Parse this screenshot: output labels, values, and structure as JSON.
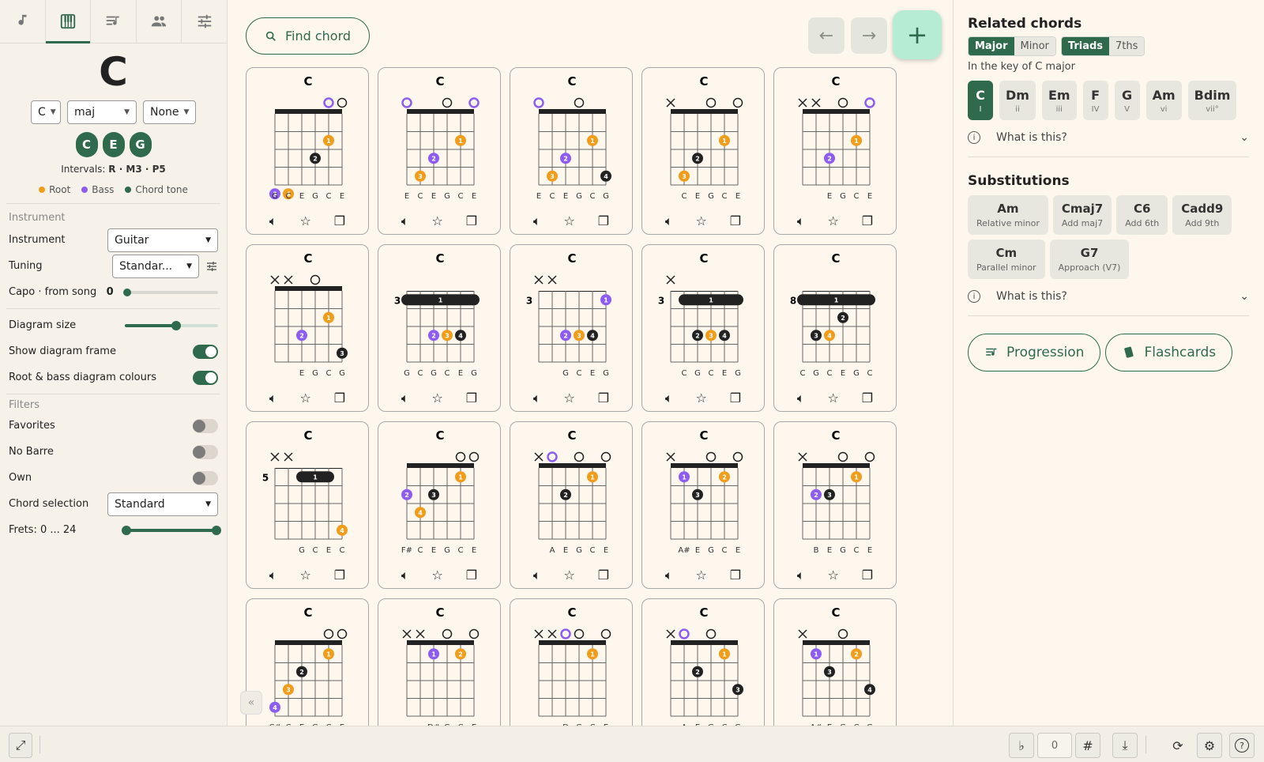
{
  "tabs": [
    "note-icon",
    "piano-icon",
    "playlist-icon",
    "people-icon",
    "sliders-icon"
  ],
  "chord": {
    "name": "C",
    "root": "C",
    "quality": "maj",
    "bass": "None",
    "notes": [
      "C",
      "E",
      "G"
    ],
    "intervals_label": "Intervals:",
    "intervals": "R · M3 · P5",
    "legend": {
      "root": "Root",
      "bass": "Bass",
      "chord_tone": "Chord tone"
    }
  },
  "colors": {
    "accent": "#2f6a4c",
    "root": "#f29d1a",
    "bass": "#8e5cf0",
    "tone": "#222222"
  },
  "settings": {
    "instrument_section": "Instrument",
    "instrument_label": "Instrument",
    "instrument_value": "Guitar",
    "tuning_label": "Tuning",
    "tuning_value": "Standar...",
    "capo_label": "Capo · from song",
    "capo_value": "0",
    "diagram_size_label": "Diagram size",
    "diagram_size_level": 0.55,
    "show_frame_label": "Show diagram frame",
    "show_frame": true,
    "root_bass_label": "Root & bass diagram colours",
    "root_bass": true,
    "filters_section": "Filters",
    "favorites_label": "Favorites",
    "favorites": false,
    "no_barre_label": "No Barre",
    "no_barre": false,
    "own_label": "Own",
    "own": false,
    "chord_selection_label": "Chord selection",
    "chord_selection_value": "Standard",
    "frets_label": "Frets: 0 ... 24",
    "frets_range": [
      0,
      24
    ]
  },
  "toolbar": {
    "find_label": "Find chord"
  },
  "diagrams": [
    {
      "name": "C",
      "base": 1,
      "markers": [
        "",
        "",
        "",
        "",
        "ob",
        "o"
      ],
      "dots": [
        [
          5,
          2,
          "r",
          1
        ],
        [
          4,
          3,
          "t",
          2
        ],
        [
          1,
          5,
          "b",
          3
        ],
        [
          2,
          5,
          "r",
          4
        ]
      ],
      "notes": [
        "G",
        "C",
        "E",
        "G",
        "C",
        "E"
      ]
    },
    {
      "name": "C",
      "base": 1,
      "markers": [
        "ob",
        "",
        "",
        "o",
        "",
        "ob"
      ],
      "dots": [
        [
          5,
          2,
          "r",
          1
        ],
        [
          3,
          3,
          "b",
          2
        ],
        [
          2,
          4,
          "r",
          3
        ]
      ],
      "notes": [
        "E",
        "C",
        "E",
        "G",
        "C",
        "E"
      ]
    },
    {
      "name": "C",
      "base": 1,
      "markers": [
        "ob",
        "",
        "",
        "o",
        "",
        ""
      ],
      "dots": [
        [
          5,
          2,
          "r",
          1
        ],
        [
          3,
          3,
          "b",
          2
        ],
        [
          2,
          4,
          "r",
          3
        ],
        [
          6,
          4,
          "t",
          4
        ]
      ],
      "notes": [
        "E",
        "C",
        "E",
        "G",
        "C",
        "G"
      ]
    },
    {
      "name": "C",
      "base": 1,
      "markers": [
        "x",
        "",
        "",
        "o",
        "",
        "o"
      ],
      "dots": [
        [
          5,
          2,
          "r",
          1
        ],
        [
          3,
          3,
          "t",
          2
        ],
        [
          2,
          4,
          "r",
          3
        ]
      ],
      "notes": [
        "",
        "C",
        "E",
        "G",
        "C",
        "E"
      ]
    },
    {
      "name": "C",
      "base": 1,
      "markers": [
        "x",
        "x",
        "",
        "o",
        "",
        "ob"
      ],
      "dots": [
        [
          5,
          2,
          "r",
          1
        ],
        [
          3,
          3,
          "b",
          2
        ]
      ],
      "notes": [
        "",
        "",
        "E",
        "G",
        "C",
        "E"
      ]
    },
    {
      "name": "C",
      "base": 1,
      "markers": [
        "x",
        "x",
        "",
        "o",
        "",
        ""
      ],
      "dots": [
        [
          5,
          2,
          "r",
          1
        ],
        [
          3,
          3,
          "b",
          2
        ],
        [
          6,
          4,
          "t",
          3
        ]
      ],
      "notes": [
        "",
        "",
        "E",
        "G",
        "C",
        "G"
      ]
    },
    {
      "name": "C",
      "base": 3,
      "barre": [
        1,
        6
      ],
      "markers": [
        "",
        "",
        "",
        "",
        "",
        ""
      ],
      "dots": [
        [
          3,
          3,
          "b",
          2
        ],
        [
          4,
          3,
          "r",
          3
        ],
        [
          5,
          3,
          "t",
          4
        ]
      ],
      "notes": [
        "G",
        "C",
        "G",
        "C",
        "E",
        "G"
      ]
    },
    {
      "name": "C",
      "base": 3,
      "markers": [
        "x",
        "x",
        "",
        "",
        "",
        ""
      ],
      "dots": [
        [
          6,
          1,
          "b",
          1
        ],
        [
          3,
          3,
          "b",
          2
        ],
        [
          4,
          3,
          "r",
          3
        ],
        [
          5,
          3,
          "t",
          4
        ]
      ],
      "notes": [
        "",
        "",
        "G",
        "C",
        "E",
        "G"
      ]
    },
    {
      "name": "C",
      "base": 3,
      "barre": [
        2,
        6
      ],
      "markers": [
        "x",
        "",
        "",
        "",
        "",
        ""
      ],
      "dots": [
        [
          3,
          3,
          "t",
          2
        ],
        [
          4,
          3,
          "r",
          3
        ],
        [
          5,
          3,
          "t",
          4
        ]
      ],
      "notes": [
        "",
        "C",
        "G",
        "C",
        "E",
        "G"
      ]
    },
    {
      "name": "C",
      "base": 8,
      "barre": [
        1,
        6
      ],
      "markers": [
        "",
        "",
        "",
        "",
        "",
        ""
      ],
      "dots": [
        [
          4,
          2,
          "t",
          2
        ],
        [
          2,
          3,
          "t",
          3
        ],
        [
          3,
          3,
          "r",
          4
        ]
      ],
      "notes": [
        "C",
        "G",
        "C",
        "E",
        "G",
        "C"
      ]
    },
    {
      "name": "C",
      "base": 5,
      "barre": [
        3,
        5
      ],
      "markers": [
        "x",
        "x",
        "",
        "",
        "",
        ""
      ],
      "dots": [
        [
          6,
          4,
          "r",
          4
        ]
      ],
      "notes": [
        "",
        "",
        "G",
        "C",
        "E",
        "C"
      ]
    },
    {
      "name": "C",
      "base": 1,
      "markers": [
        "",
        "",
        "",
        "",
        "o",
        "o"
      ],
      "dots": [
        [
          5,
          1,
          "r",
          1
        ],
        [
          1,
          2,
          "b",
          2
        ],
        [
          3,
          2,
          "t",
          3
        ],
        [
          2,
          3,
          "r",
          4
        ]
      ],
      "notes": [
        "F#",
        "C",
        "E",
        "G",
        "C",
        "E"
      ]
    },
    {
      "name": "C",
      "base": 1,
      "markers": [
        "x",
        "ob",
        "",
        "o",
        "",
        "o"
      ],
      "dots": [
        [
          5,
          1,
          "r",
          1
        ],
        [
          3,
          2,
          "t",
          2
        ]
      ],
      "notes": [
        "",
        "A",
        "E",
        "G",
        "C",
        "E"
      ]
    },
    {
      "name": "C",
      "base": 1,
      "markers": [
        "x",
        "",
        "",
        "o",
        "",
        "o"
      ],
      "dots": [
        [
          2,
          1,
          "b",
          1
        ],
        [
          5,
          1,
          "r",
          2
        ],
        [
          3,
          2,
          "t",
          3
        ]
      ],
      "notes": [
        "",
        "A#",
        "E",
        "G",
        "C",
        "E"
      ]
    },
    {
      "name": "C",
      "base": 1,
      "markers": [
        "x",
        "",
        "",
        "o",
        "",
        "o"
      ],
      "dots": [
        [
          5,
          1,
          "r",
          1
        ],
        [
          2,
          2,
          "b",
          2
        ],
        [
          3,
          2,
          "t",
          3
        ]
      ],
      "notes": [
        "",
        "B",
        "E",
        "G",
        "C",
        "E"
      ]
    },
    {
      "name": "C",
      "base": 1,
      "markers": [
        "",
        "",
        "",
        "",
        "o",
        "o"
      ],
      "dots": [
        [
          5,
          1,
          "r",
          1
        ],
        [
          3,
          2,
          "t",
          2
        ],
        [
          2,
          3,
          "r",
          3
        ],
        [
          1,
          4,
          "b",
          4
        ]
      ],
      "notes": [
        "C#",
        "C",
        "E",
        "G",
        "C",
        "E"
      ]
    },
    {
      "name": "C",
      "base": 1,
      "markers": [
        "x",
        "x",
        "",
        "o",
        "",
        "o"
      ],
      "dots": [
        [
          3,
          1,
          "b",
          1
        ],
        [
          5,
          1,
          "r",
          2
        ]
      ],
      "notes": [
        "",
        "",
        "D#",
        "G",
        "C",
        "E"
      ]
    },
    {
      "name": "C",
      "base": 1,
      "markers": [
        "x",
        "x",
        "ob",
        "o",
        "",
        "o"
      ],
      "dots": [
        [
          5,
          1,
          "r",
          1
        ]
      ],
      "notes": [
        "",
        "",
        "D",
        "G",
        "C",
        "E"
      ]
    },
    {
      "name": "C",
      "base": 1,
      "markers": [
        "x",
        "ob",
        "",
        "o",
        "",
        ""
      ],
      "dots": [
        [
          5,
          1,
          "r",
          1
        ],
        [
          3,
          2,
          "t",
          2
        ],
        [
          6,
          3,
          "t",
          3
        ]
      ],
      "notes": [
        "",
        "A",
        "E",
        "G",
        "C",
        "G"
      ]
    },
    {
      "name": "C",
      "base": 1,
      "markers": [
        "x",
        "",
        "",
        "o",
        "",
        ""
      ],
      "dots": [
        [
          2,
          1,
          "b",
          1
        ],
        [
          5,
          1,
          "r",
          2
        ],
        [
          3,
          2,
          "t",
          3
        ],
        [
          6,
          3,
          "t",
          4
        ]
      ],
      "notes": [
        "",
        "A#",
        "E",
        "G",
        "C",
        "G"
      ]
    }
  ],
  "related": {
    "title": "Related chords",
    "mode_tabs": [
      {
        "label": "Major",
        "on": true
      },
      {
        "label": "Minor",
        "on": false
      }
    ],
    "type_tabs": [
      {
        "label": "Triads",
        "on": true
      },
      {
        "label": "7ths",
        "on": false
      }
    ],
    "key_text": "In the key of C major",
    "degrees": [
      {
        "name": "C",
        "roman": "I",
        "on": true
      },
      {
        "name": "Dm",
        "roman": "ii",
        "on": false
      },
      {
        "name": "Em",
        "roman": "iii",
        "on": false
      },
      {
        "name": "F",
        "roman": "IV",
        "on": false
      },
      {
        "name": "G",
        "roman": "V",
        "on": false
      },
      {
        "name": "Am",
        "roman": "vi",
        "on": false
      },
      {
        "name": "Bdim",
        "roman": "vii°",
        "on": false
      }
    ],
    "what_label": "What is this?"
  },
  "substitutions": {
    "title": "Substitutions",
    "items": [
      {
        "name": "Am",
        "desc": "Relative minor"
      },
      {
        "name": "Cmaj7",
        "desc": "Add maj7"
      },
      {
        "name": "C6",
        "desc": "Add 6th"
      },
      {
        "name": "Cadd9",
        "desc": "Add 9th"
      },
      {
        "name": "Cm",
        "desc": "Parallel minor"
      },
      {
        "name": "G7",
        "desc": "Approach (V7)"
      }
    ],
    "what_label": "What is this?"
  },
  "actions": {
    "progression_label": "Progression",
    "flashcards_label": "Flashcards"
  },
  "bottom": {
    "flat": "♭",
    "transpose_value": "0",
    "sharp": "#"
  }
}
